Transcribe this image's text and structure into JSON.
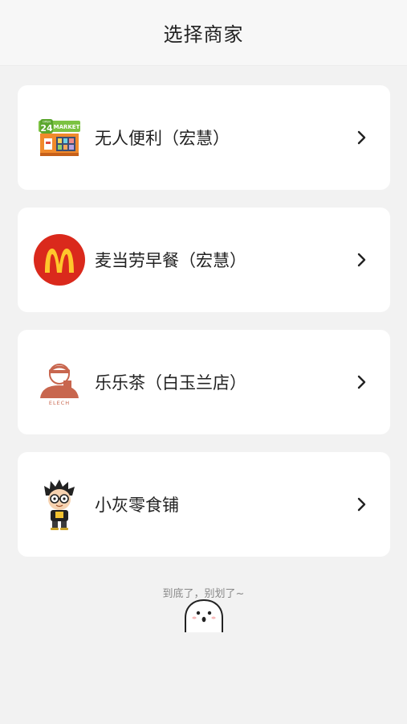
{
  "header": {
    "title": "选择商家"
  },
  "merchants": [
    {
      "name": "无人便利（宏慧）",
      "icon": "market-24-store-icon",
      "logo_text": "24",
      "logo_subtext": "MARKET",
      "logo_tag": "OPEN"
    },
    {
      "name": "麦当劳早餐（宏慧）",
      "icon": "mcdonalds-logo-icon",
      "logo_color": "#da291c",
      "logo_arch_color": "#ffc72c"
    },
    {
      "name": "乐乐茶（白玉兰店）",
      "icon": "lelecha-logo-icon",
      "logo_text": "ELECH",
      "logo_color": "#c8664e"
    },
    {
      "name": "小灰零食铺",
      "icon": "cartoon-boy-avatar-icon"
    }
  ],
  "footer": {
    "text": "到底了，别划了~",
    "icon": "ghost-mascot-icon"
  }
}
